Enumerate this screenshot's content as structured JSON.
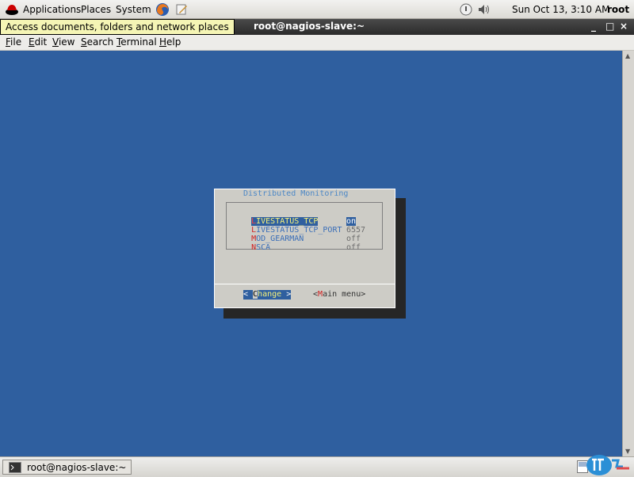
{
  "top_panel": {
    "applications": "Applications",
    "places": "Places",
    "system": "System",
    "datetime": "Sun Oct 13,  3:10 AM",
    "user": "root"
  },
  "tooltip": "Access documents, folders and network places",
  "window": {
    "title": "root@nagios-slave:~",
    "minimize": "_",
    "maximize": "□",
    "close": "×"
  },
  "menubar": [
    "File",
    "Edit",
    "View",
    "Search",
    "Terminal",
    "Help"
  ],
  "dialog": {
    "title": "Distributed Monitoring",
    "items": [
      {
        "hotkey": "L",
        "rest": "IVESTATUS_TCP",
        "value": "on",
        "selected": true
      },
      {
        "hotkey": "L",
        "rest": "IVESTATUS_TCP_PORT",
        "value": "6557",
        "selected": false
      },
      {
        "hotkey": "M",
        "rest": "OD_GEARMAN",
        "value": "off",
        "selected": false
      },
      {
        "hotkey": "N",
        "rest": "SCA",
        "value": "off",
        "selected": false
      }
    ],
    "btn_change": {
      "open": "< ",
      "cursor": "C",
      "rest": "hange",
      "close": " >"
    },
    "btn_main": {
      "open": "<",
      "hotkey": "M",
      "rest": "ain menu",
      "close": ">"
    }
  },
  "taskbar": {
    "label": "root@nagios-slave:~"
  },
  "colors": {
    "terminal_bg": "#2f5f9f",
    "dialog_bg": "#cdccc6",
    "highlight_fg": "#f7f27a",
    "hotkey": "#d02020"
  }
}
